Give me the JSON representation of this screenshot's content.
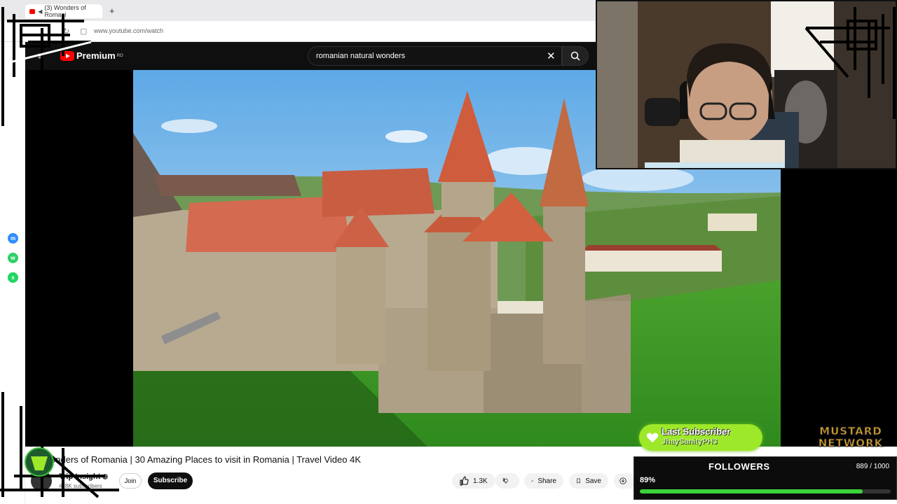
{
  "browser": {
    "tab_title": "(3) Wonders of Romani",
    "url": "www.youtube.com/watch",
    "new_tab": "+"
  },
  "youtube": {
    "logo_text": "Premium",
    "logo_region": "RO",
    "search_value": "romanian natural wonders",
    "video_title": "Wonders of Romania | 30 Amazing Places to visit in Romania | Travel Video 4K",
    "channel_name": "Trip Insight",
    "channel_subs": "428K subscribers",
    "join_label": "Join",
    "subscribe_label": "Subscribe",
    "like_count": "1.3K",
    "share_label": "Share",
    "save_label": "Save"
  },
  "overlay": {
    "last_sub_title": "Last Subscriber",
    "last_sub_name": "JhaySanityPH3",
    "brand_line1": "MUSTARD",
    "brand_line2": "NETWORK",
    "followers_label": "FOLLOWERS",
    "followers_count": "889 / 1000",
    "followers_pct_label": "89%",
    "followers_progress": 0.889
  },
  "colors": {
    "yt_red": "#ff0000",
    "yt_dark": "#0f0f0f",
    "goal_green": "#3bd23b",
    "sub_badge": "#9ee82a",
    "brand_gold": "#e5a92a"
  },
  "icons": [
    "menu-icon",
    "search-icon",
    "close-icon",
    "like-icon",
    "dislike-icon",
    "share-icon",
    "save-icon",
    "download-icon",
    "heart-icon",
    "messenger-icon",
    "whatsapp-icon",
    "spotify-icon"
  ]
}
